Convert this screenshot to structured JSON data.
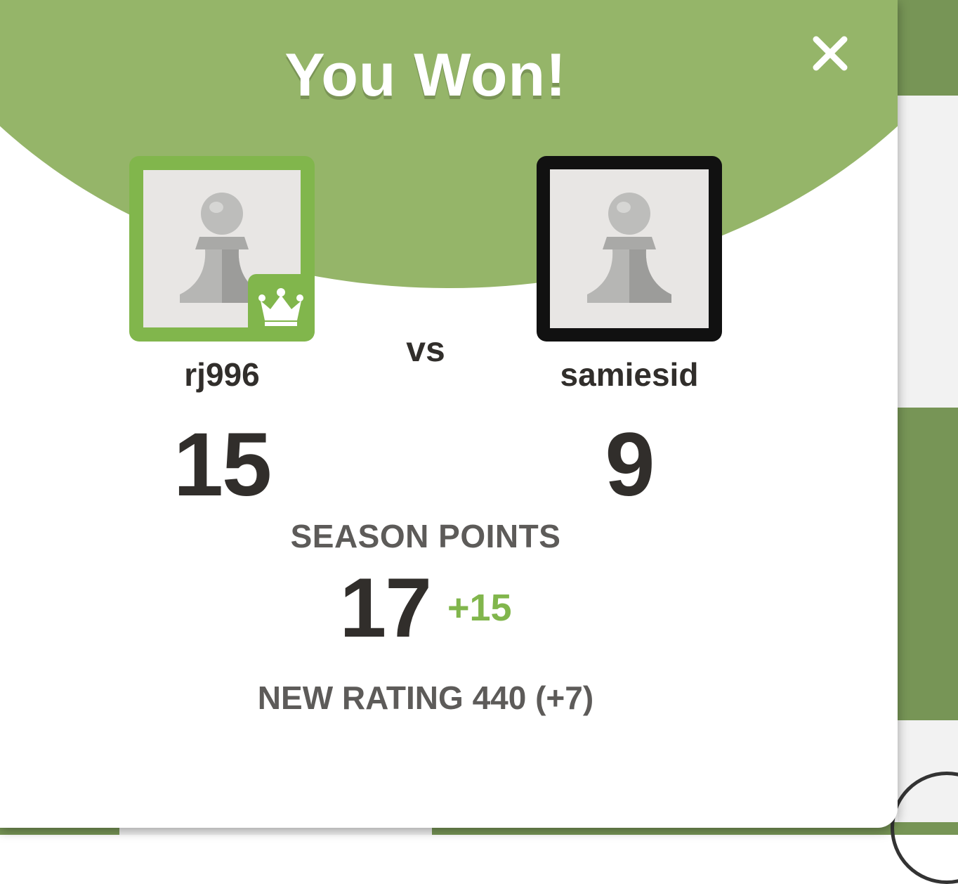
{
  "modal": {
    "title": "You Won!",
    "close_icon": "close-icon",
    "vs_label": "vs"
  },
  "players": {
    "left": {
      "username": "rj996",
      "score": "15",
      "avatar_icon": "pawn-icon",
      "badge_icon": "crown-icon"
    },
    "right": {
      "username": "samiesid",
      "score": "9",
      "avatar_icon": "pawn-icon"
    }
  },
  "season": {
    "label": "SEASON POINTS",
    "value": "17",
    "delta": "+15"
  },
  "rating": {
    "text": "NEW RATING 440 (+7)"
  },
  "colors": {
    "header_green": "#95b569",
    "accent_green": "#81b64c",
    "text_dark": "#312e2b",
    "text_gray": "#5d5b59"
  }
}
